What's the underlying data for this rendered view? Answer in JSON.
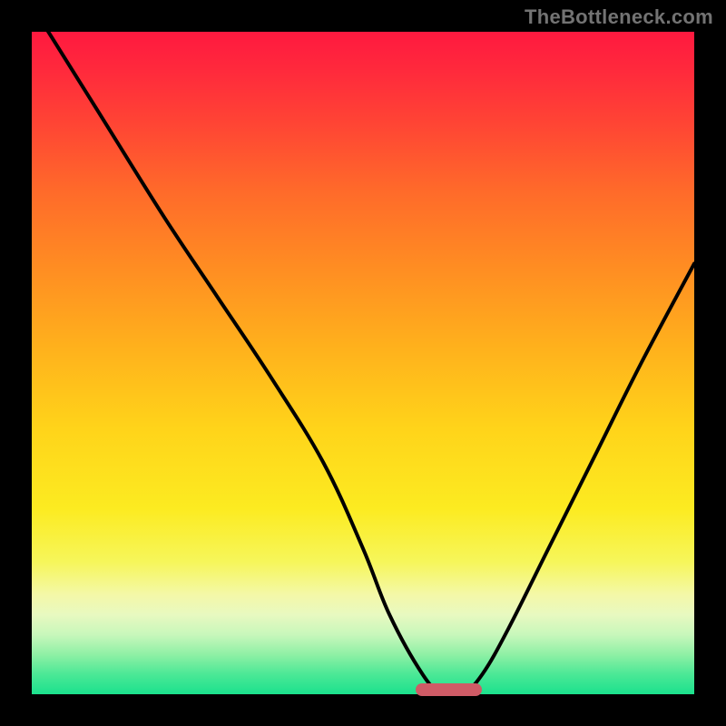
{
  "watermark": "TheBottleneck.com",
  "chart_data": {
    "type": "line",
    "title": "",
    "xlabel": "",
    "ylabel": "",
    "xlim": [
      0,
      100
    ],
    "ylim": [
      0,
      100
    ],
    "grid": false,
    "series": [
      {
        "name": "bottleneck-curve",
        "x": [
          0,
          10,
          20,
          28,
          36,
          44,
          50,
          54,
          59,
          62,
          65,
          68,
          72,
          78,
          85,
          92,
          100
        ],
        "values": [
          104,
          88,
          72,
          60,
          48,
          35,
          22,
          12,
          3,
          0,
          0,
          3,
          10,
          22,
          36,
          50,
          65
        ]
      }
    ],
    "optimal_range_x": [
      58,
      68
    ],
    "marker_color": "#cf5b66",
    "curve_color": "#000000"
  }
}
